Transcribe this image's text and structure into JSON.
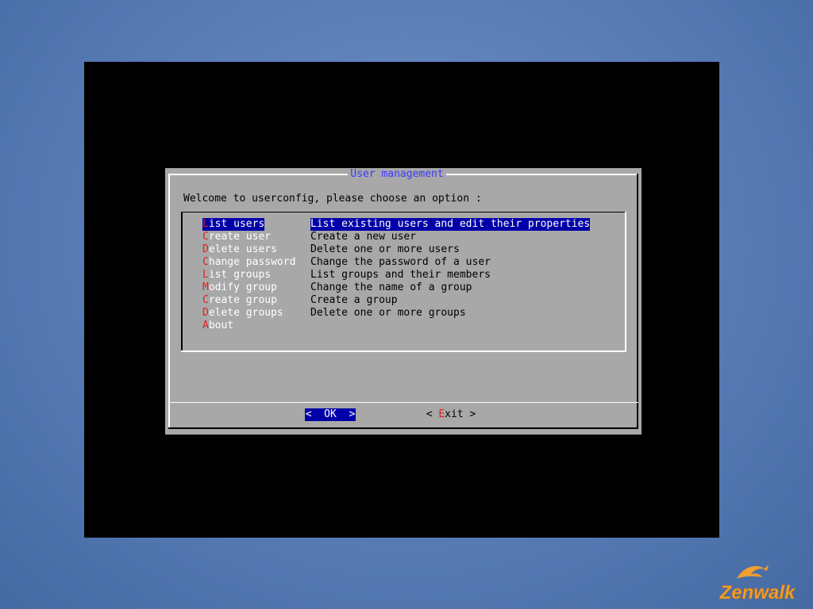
{
  "dialog": {
    "title": "User management",
    "welcome": "Welcome to userconfig, please choose an option :"
  },
  "menu": {
    "items": [
      {
        "hotkey": "L",
        "rest": "ist users",
        "desc": "List existing users and edit their properties",
        "selected": true
      },
      {
        "hotkey": "C",
        "rest": "reate user",
        "desc": "Create a new user"
      },
      {
        "hotkey": "D",
        "rest": "elete users",
        "desc": "Delete one or more users"
      },
      {
        "hotkey": "C",
        "rest": "hange password",
        "desc": "Change the password of a user"
      },
      {
        "hotkey": "L",
        "rest": "ist groups",
        "desc": "List groups and their members"
      },
      {
        "hotkey": "M",
        "rest": "odify group",
        "desc": "Change the name of a group"
      },
      {
        "hotkey": "C",
        "rest": "reate group",
        "desc": "Create a group"
      },
      {
        "hotkey": "D",
        "rest": "elete groups",
        "desc": "Delete one or more groups"
      },
      {
        "hotkey": "A",
        "rest": "bout",
        "desc": ""
      }
    ]
  },
  "buttons": {
    "ok": {
      "left": "<",
      "label": "OK",
      "right": ">"
    },
    "exit": {
      "left": "<",
      "hotkey": "E",
      "rest": "xit",
      "right": ">"
    }
  },
  "logo": {
    "text": "Zenwalk"
  },
  "colors": {
    "desktop": "#5c7fb8",
    "dialog_bg": "#a8a8a8",
    "selection": "#0000a8",
    "title": "#3a3aff",
    "hotkey": "#e02020",
    "logo": "#f0a030"
  },
  "icons": [
    "zenwalk-dolphin-logo"
  ]
}
